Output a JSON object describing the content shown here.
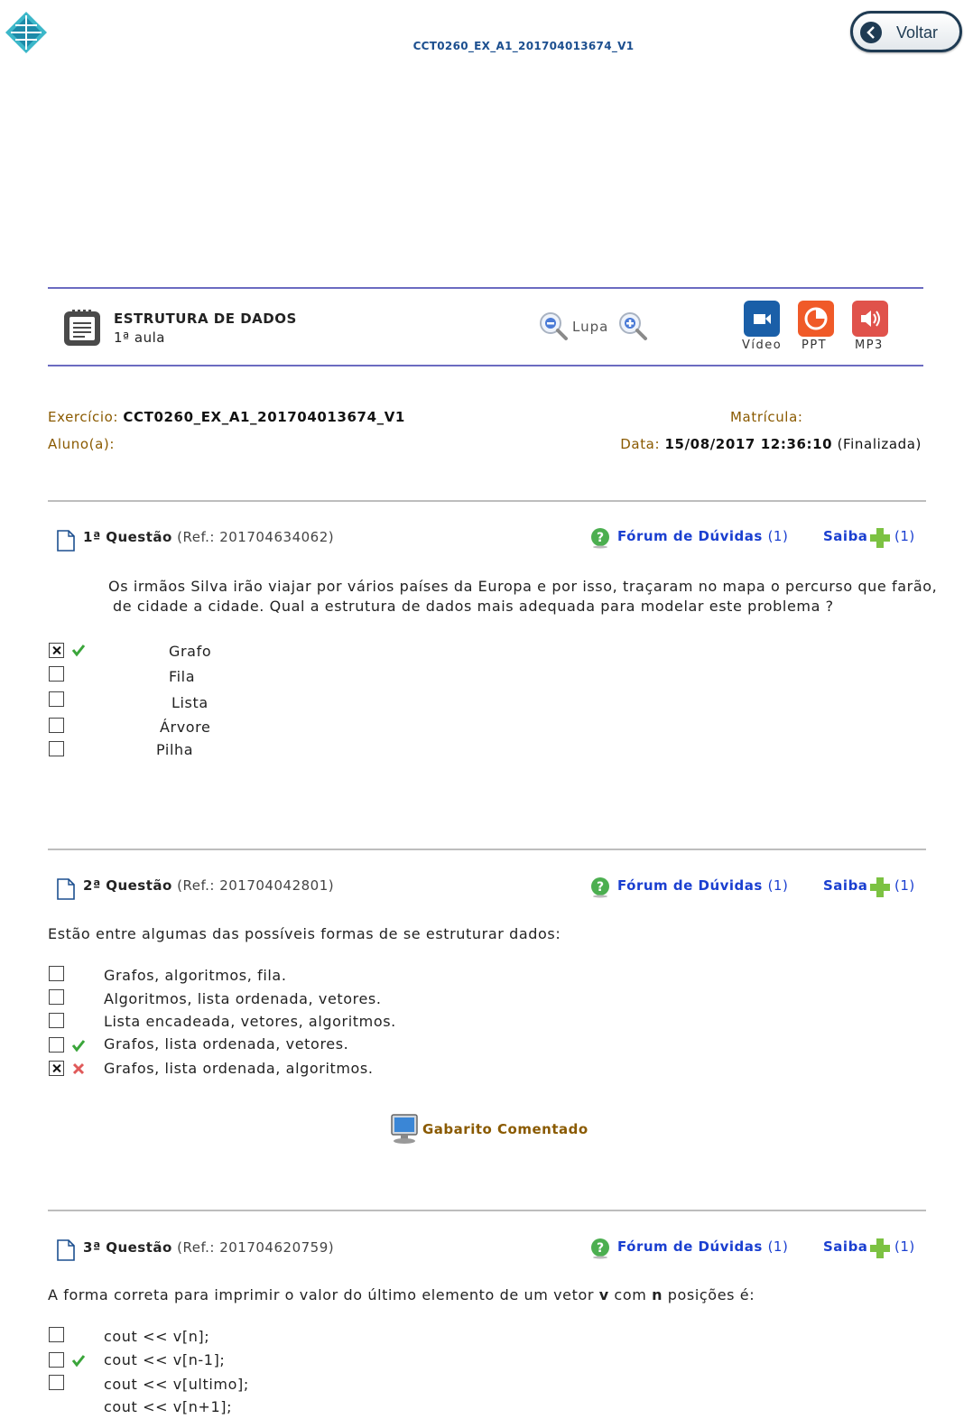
{
  "header": {
    "doc_code": "CCT0260_EX_A1_201704013674_V1",
    "back_label": "Voltar"
  },
  "course": {
    "title": "ESTRUTURA DE DADOS",
    "lesson": "1ª aula",
    "zoom_label": "Lupa",
    "media": [
      {
        "label": "Vídeo",
        "color": "#1a5fa8"
      },
      {
        "label": "PPT",
        "color": "#f05a28"
      },
      {
        "label": "MP3",
        "color": "#e0524b"
      }
    ]
  },
  "info": {
    "exercise_key": "Exercício:",
    "exercise_val": "CCT0260_EX_A1_201704013674_V1",
    "registration_key": "Matrícula:",
    "student_key": "Aluno(a):",
    "date_key": "Data:",
    "date_val": "15/08/2017 12:36:10",
    "date_status": "(Finalizada)"
  },
  "common": {
    "forum_label": "Fórum de Dúvidas",
    "forum_count": "(1)",
    "saiba_label": "Saiba",
    "saiba_count": "(1)",
    "question_word": "Questão"
  },
  "questions": [
    {
      "number": "1ª",
      "ref": "(Ref.: 201704634062)",
      "statement_line1": "Os irmãos Silva irão viajar por vários países da Europa e por isso, traçaram no mapa o percurso que farão,",
      "statement_line2": "de cidade a cidade.  Qual a estrutura de dados mais adequada para modelar este problema ?",
      "options": [
        "Grafo",
        "Fila",
        "Lista",
        "Árvore",
        "Pilha"
      ]
    },
    {
      "number": "2ª",
      "ref": "(Ref.: 201704042801)",
      "statement": "Estão entre algumas das possíveis formas de se estruturar dados:",
      "options": [
        "Grafos, algoritmos, fila.",
        "Algoritmos, lista ordenada, vetores.",
        "Lista encadeada, vetores, algoritmos.",
        "Grafos, lista ordenada, vetores.",
        "Grafos, lista ordenada, algoritmos."
      ],
      "gabarito_label": "Gabarito Comentado"
    },
    {
      "number": "3ª",
      "ref": "(Ref.: 201704620759)",
      "statement_pre": "A forma correta para imprimir o valor do último elemento de um vetor ",
      "statement_v": "v",
      "statement_mid": " com ",
      "statement_n": "n",
      "statement_post": " posições é:",
      "options": [
        "cout << v[n];",
        "cout << v[n-1];",
        "cout << v[ultimo];",
        "cout << v[n+1];"
      ]
    }
  ]
}
